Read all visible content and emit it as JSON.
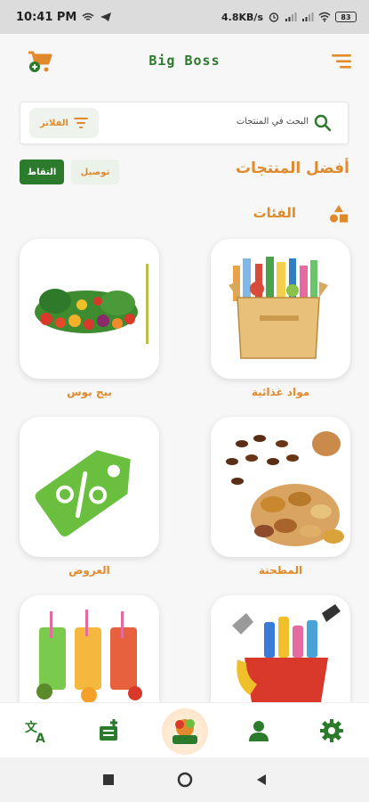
{
  "status_bar": {
    "time": "10:41 PM",
    "speed": "4.8KB/s",
    "battery": "83"
  },
  "header": {
    "brand": "Big Boss",
    "cart_icon": "cart-icon",
    "menu_icon": "menu-icon"
  },
  "search": {
    "placeholder": "البحث في المنتجات",
    "filter_label": "الفلاتر"
  },
  "delivery_options": {
    "pickup": "التقاط",
    "delivery": "توصيل"
  },
  "best_products_title": "أفضل المنتجات",
  "categories_title": "الفئات",
  "categories": [
    {
      "label": "مواد غذائية",
      "image": "grocery-box"
    },
    {
      "label": "بيج بوس",
      "image": "vegetables"
    },
    {
      "label": "المطحنة",
      "image": "nuts-and-dates"
    },
    {
      "label": "العروض",
      "image": "discount-tag"
    },
    {
      "label": "",
      "image": "cleaning-supplies"
    },
    {
      "label": "",
      "image": "juices"
    }
  ],
  "bottom_nav": [
    "settings-icon",
    "profile-icon",
    "home-logo",
    "orders-icon",
    "translate-icon"
  ],
  "colors": {
    "primary_green": "#2c7a2c",
    "accent_orange": "#e08a2c"
  }
}
